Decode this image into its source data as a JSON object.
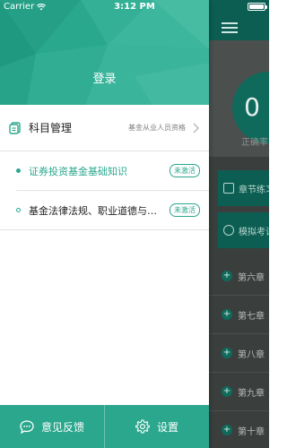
{
  "status_bar": {
    "carrier": "Carrier",
    "time": "3:12 PM"
  },
  "drawer": {
    "login_label": "登录",
    "subject_management": {
      "title": "科目管理",
      "qualification": "基金从业人员资格"
    },
    "courses": [
      {
        "name": "证券投资基金基础知识",
        "badge": "未激活",
        "active": true
      },
      {
        "name": "基金法律法规、职业道德与…",
        "badge": "未激活",
        "active": false
      }
    ],
    "bottom_bar": {
      "feedback_label": "意见反馈",
      "settings_label": "设置"
    }
  },
  "background_app": {
    "score": "0",
    "score_label": "正确率",
    "card1_label": "章节练习",
    "card2_label": "模拟考试",
    "chapters": [
      "第六章",
      "第七章",
      "第八章",
      "第九章",
      "第十章"
    ]
  },
  "colors": {
    "accent": "#2ba78d",
    "background_dim": "#3a3f3e"
  }
}
